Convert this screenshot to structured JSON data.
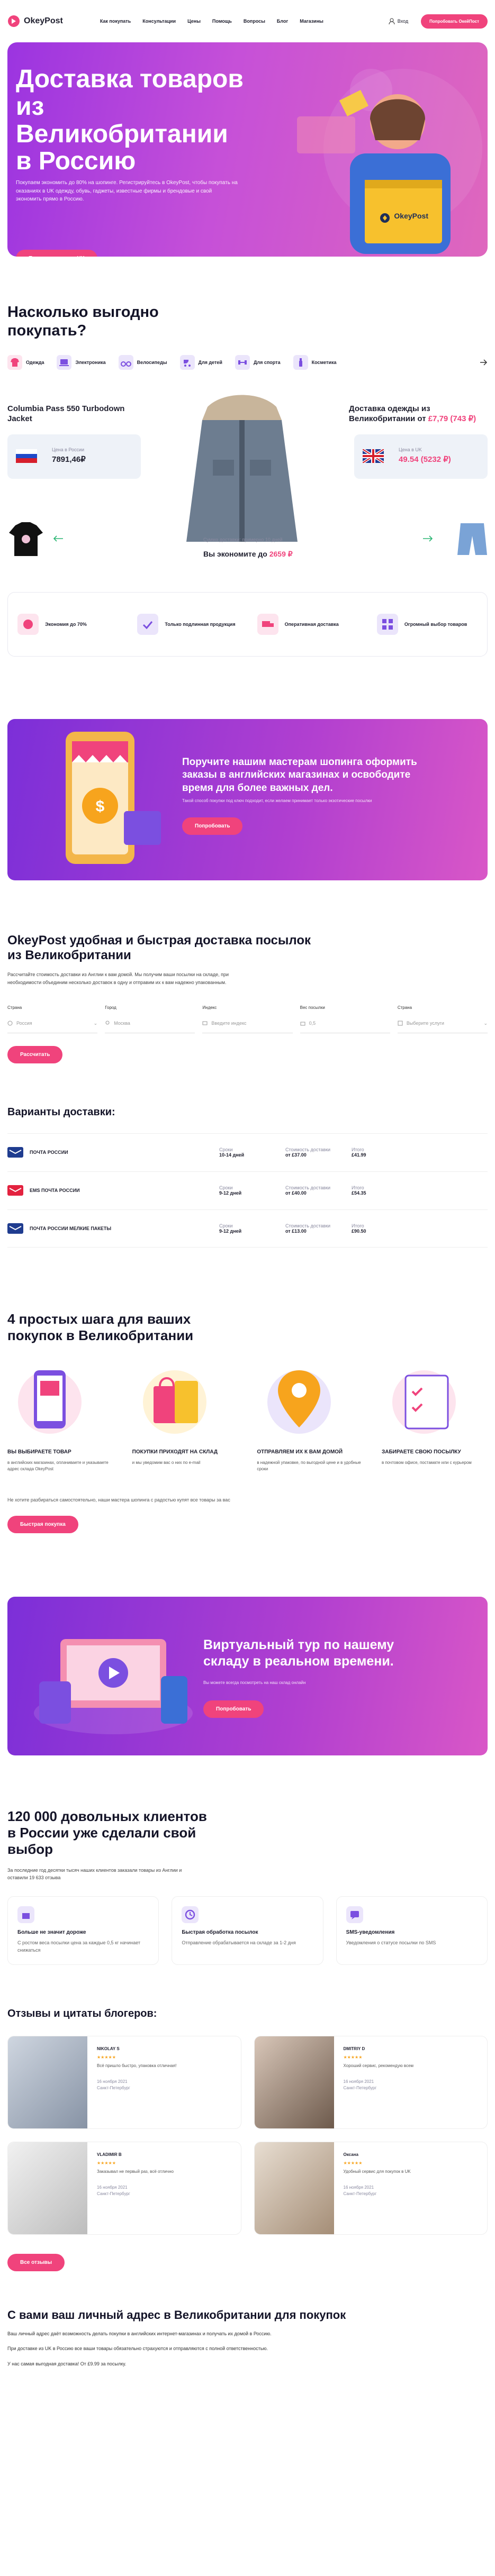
{
  "header": {
    "brand": "OkeyPost",
    "nav": [
      "Как покупать",
      "Консультации",
      "Цены",
      "Помощь",
      "Вопросы",
      "Блог",
      "Магазины"
    ],
    "login": "Вход",
    "cta": "Попробовать ОкейПост"
  },
  "hero": {
    "title": "Доставка товаров из Великобритании в Россию",
    "text": "Покупаем экономить до 80% на шопинге. Регистрируйтесь в OkeyPost, чтобы покупать на оказаниях в UK одежду, обувь, гаджеты, известные фирмы и брендовые и свой экономить прямо в Россию.",
    "button": "Получить адрес в UK",
    "box_label": "OkeyPost"
  },
  "benefits": {
    "title": "Насколько выгодно покупать?",
    "categories": [
      "Одежда",
      "Электроника",
      "Велосипеды",
      "Для детей",
      "Для спорта",
      "Косметика"
    ],
    "product_name": "Columbia Pass 550 Turbodown Jacket",
    "price_ru_label": "Цена в России",
    "price_ru": "7891,46₽",
    "uk_title": "Доставка одежды из Великобритании от",
    "uk_price": "£7,79 (743 ₽)",
    "price_uk_label": "Цена в UK",
    "price_uk": "49.54 (5232 ₽)",
    "delivery_note": "Сумма доставки: примерно 10 дней",
    "saving_label": "Вы экономите до",
    "saving_value": "2659 ₽",
    "features": [
      "Экономия до 70%",
      "Только подлинная продукция",
      "Оперативная доставка",
      "Огромный выбор товаров"
    ]
  },
  "promo1": {
    "title": "Поручите нашим мастерам шопинга оформить заказы в английских магазинах и освободите время для более важных дел.",
    "text": "Такой способ покупки под ключ подходит, если желаем принимает только экзотические посылки",
    "button": "Попробовать"
  },
  "calc": {
    "title": "OkeyPost удобная и быстрая доставка посылок из Великобритании",
    "text": "Рассчитайте стоимость доставки из Англии к вам домой. Мы получим ваши посылки на складе, при необходимости объединим несколько доставок в одну и отправим их к вам надежно упакованным.",
    "fields": [
      {
        "label": "Страна",
        "value": "Россия"
      },
      {
        "label": "Город",
        "value": "Москва"
      },
      {
        "label": "Индекс",
        "value": "Введите индекс"
      },
      {
        "label": "Вес посылки",
        "value": "0,5"
      },
      {
        "label": "Страна",
        "value": "Выберите услуги"
      }
    ],
    "button": "Рассчитать"
  },
  "variants": {
    "title": "Варианты доставки:",
    "col_days": "Сроки",
    "col_cost": "Стоимость доставки",
    "col_total": "Итого",
    "rows": [
      {
        "name": "ПОЧТА РОССИИ",
        "days": "10-14 дней",
        "cost": "от £37.00",
        "total": "£41.99"
      },
      {
        "name": "EMS ПОЧТА РОССИИ",
        "days": "9-12 дней",
        "cost": "от £40.00",
        "total": "£54.35"
      },
      {
        "name": "ПОЧТА РОССИИ МЕЛКИЕ ПАКЕТЫ",
        "days": "9-12 дней",
        "cost": "от £13.00",
        "total": "£90.50"
      }
    ]
  },
  "steps": {
    "title": "4 простых шага для ваших покупок в Великобритании",
    "items": [
      {
        "title": "ВЫ ВЫБИРАЕТЕ ТОВАР",
        "text": "в английских магазинах, оплачиваете и указываете адрес склада OkeyPost"
      },
      {
        "title": "ПОКУПКИ ПРИХОДЯТ НА СКЛАД",
        "text": "и мы уведомим вас о них по e-mail"
      },
      {
        "title": "ОТПРАВЛЯЕМ ИХ К ВАМ ДОМОЙ",
        "text": "в надежной упаковке, по выгодной цене и в удобные сроки"
      },
      {
        "title": "ЗАБИРАЕТЕ СВОЮ ПОСЫЛКУ",
        "text": "в почтовом офисе, постамате или с курьером"
      }
    ],
    "hint": "Не хотите разбираться самостоятельно, наши мастера шопинга с радостью купят все товары за вас",
    "button": "Быстрая покупка"
  },
  "promo2": {
    "title": "Виртуальный тур по нашему складу в реальном времени.",
    "text": "Вы можете всегда посмотреть на наш склад онлайн",
    "button": "Попробовать"
  },
  "clients": {
    "title": "120 000 довольных клиентов в России уже сделали свой выбор",
    "text": "За последние год десятки тысяч наших клиентов заказали товары из Англии и оставили 19 633 отзыва",
    "items": [
      {
        "title": "Больше не значит дороже",
        "text": "С ростом веса посылки цена за каждые 0,5 кг начинает снижаться"
      },
      {
        "title": "Быстрая обработка посылок",
        "text": "Отправление обрабатывается на складе за 1-2 дня"
      },
      {
        "title": "SMS-уведомления",
        "text": "Уведомления о статусе посылки по SMS"
      }
    ]
  },
  "reviews": {
    "title": "Отзывы и цитаты блогеров:",
    "items": [
      {
        "name": "NIKOLAY S",
        "text": "Всё пришло быстро, упаковка отличная!",
        "date": "16 ноября 2021",
        "city": "Санкт-Петербург"
      },
      {
        "name": "DMITRIY D",
        "text": "Хороший сервис, рекомендую всем",
        "date": "16 ноября 2021",
        "city": "Санкт-Петербург"
      },
      {
        "name": "VLADIMIR B",
        "text": "Заказывал не первый раз, всё отлично",
        "date": "16 ноября 2021",
        "city": "Санкт-Петербург"
      },
      {
        "name": "Оксана",
        "text": "Удобный сервис для покупок в UK",
        "date": "16 ноября 2021",
        "city": "Санкт-Петербург"
      }
    ],
    "button": "Все отзывы"
  },
  "address": {
    "title": "С вами ваш личный адрес в Великобритании для покупок",
    "p1": "Ваш личный адрес даёт возможность делать покупки в английских интернет-магазинах и получать их домой в Россию.",
    "p2": "При доставке из UK в Россию все ваши товары обязательно страхуются и отправляются с полной ответственностью.",
    "p3": "У нас самая выгодная доставка! От £9.99 за посылку."
  }
}
